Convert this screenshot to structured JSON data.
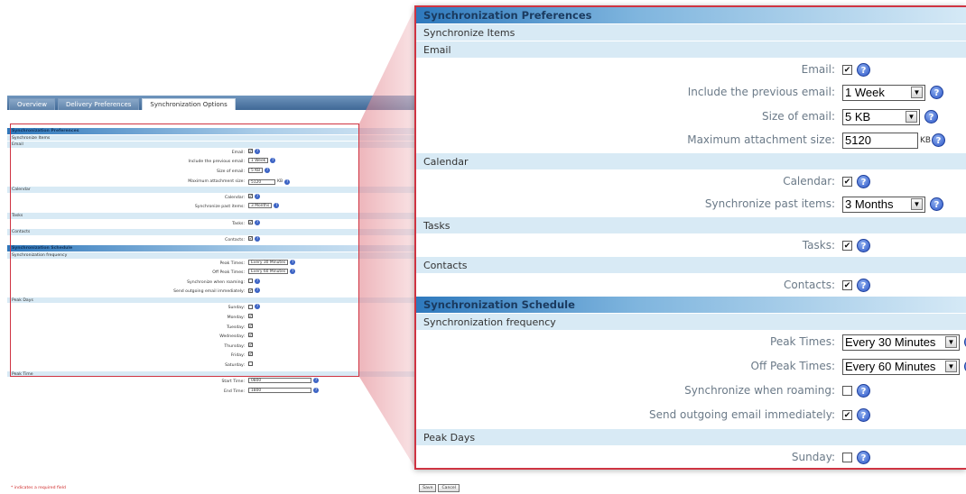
{
  "tabs": [
    "Overview",
    "Delivery Preferences",
    "Synchronization Options"
  ],
  "active_tab": "Synchronization Options",
  "sync_prefs": {
    "title": "Synchronization Preferences",
    "sync_items": "Synchronize Items",
    "email_section": "Email",
    "email_label": "Email:",
    "include_prev_label": "Include the previous email:",
    "include_prev_value": "1 Week",
    "size_label": "Size of email:",
    "size_value": "5 KB",
    "max_attach_label": "Maximum attachment size:",
    "max_attach_value": "5120",
    "kb_unit": "KB",
    "calendar_section": "Calendar",
    "calendar_label": "Calendar:",
    "past_items_label": "Synchronize past items:",
    "past_items_value": "3 Months",
    "tasks_section": "Tasks",
    "tasks_label": "Tasks:",
    "contacts_section": "Contacts",
    "contacts_label": "Contacts:"
  },
  "sync_schedule": {
    "title": "Synchronization Schedule",
    "frequency": "Synchronization frequency",
    "peak_label": "Peak Times:",
    "peak_value": "Every 30 Minutes",
    "offpeak_label": "Off Peak Times:",
    "offpeak_value": "Every 60 Minutes",
    "roaming_label": "Synchronize when roaming:",
    "send_label": "Send outgoing email immediately:",
    "peak_days": "Peak Days",
    "days": [
      {
        "label": "Sunday:",
        "checked": false
      },
      {
        "label": "Monday:",
        "checked": true
      },
      {
        "label": "Tuesday:",
        "checked": true
      },
      {
        "label": "Wednesday:",
        "checked": true
      },
      {
        "label": "Thursday:",
        "checked": true
      },
      {
        "label": "Friday:",
        "checked": true
      },
      {
        "label": "Saturday:",
        "checked": false
      }
    ],
    "peak_time": "Peak Time",
    "start_label": "Start Time:",
    "start_value": "0800",
    "end_label": "End Time:",
    "end_value": "1800"
  },
  "footer": {
    "required_note": "* indicates a required field",
    "save": "Save",
    "cancel": "Cancel"
  },
  "check_mark": "✔",
  "help_glyph": "?",
  "dropdown_arrow": "▼",
  "accent_color": "#2e79bd",
  "highlight_color": "#cf3442"
}
